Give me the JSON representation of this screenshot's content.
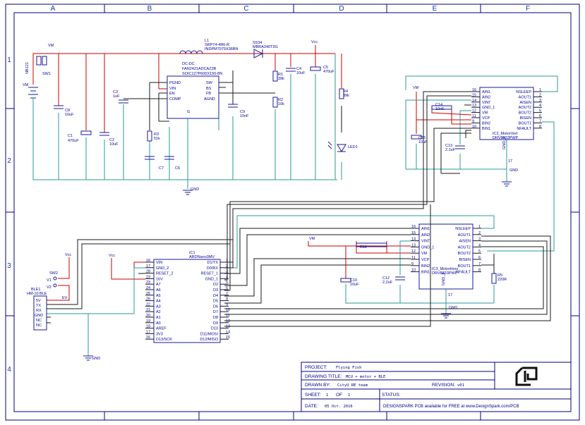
{
  "frame": {
    "columns": [
      "A",
      "B",
      "C",
      "D",
      "E",
      "F"
    ],
    "rows": [
      "1",
      "2",
      "3",
      "4"
    ]
  },
  "colors": {
    "wire_power": "#cc0000",
    "wire_signal": "#1a1a1a",
    "wire_ground": "#2a9a9a",
    "component": "#1a1a99",
    "label_text": "#000099",
    "frame": "#000080"
  },
  "power_section": {
    "vin_net": "VM",
    "vbat_net": "VM",
    "bat_label": "NB121",
    "switch_label": "SW1",
    "inductor": {
      "ref": "L1",
      "part": "SRP74-4R6-R",
      "value": "INDPM7979X36BN"
    },
    "diode": {
      "ref": "SS34",
      "part": "MBRA340T3G"
    },
    "vcc_net": "Vcc",
    "regulator": {
      "title": "DC-DC",
      "part": "FAN2421ADCAZ2B",
      "package": "SOIC127P600X150-8N",
      "pins_left": [
        "PGND",
        "VIN",
        "EN",
        "COMP"
      ],
      "pins_right": [
        "SW",
        "BS",
        "FB",
        "AGND"
      ],
      "pin_bottom": "G"
    },
    "caps": [
      {
        "ref": "C8",
        "value": "10uF"
      },
      {
        "ref": "C1",
        "value": "470uF"
      },
      {
        "ref": "C2",
        "value": "10uF"
      },
      {
        "ref": "C3",
        "value": "1uF"
      },
      {
        "ref": "C7",
        "value": ""
      },
      {
        "ref": "C6",
        "value": ""
      },
      {
        "ref": "C9",
        "value": "10nF"
      },
      {
        "ref": "C4",
        "value": "10uF"
      },
      {
        "ref": "C5",
        "value": "470uF"
      }
    ],
    "resistors": [
      {
        "ref": "R1",
        "value": "39k"
      },
      {
        "ref": "R2",
        "value": "10k"
      },
      {
        "ref": "R3",
        "value": "51k"
      },
      {
        "ref": "R4",
        "value": "39k"
      }
    ],
    "led": "LED1",
    "gnd": "GND"
  },
  "driver1": {
    "ref": "IC2_MotorVert",
    "part": "DRV8833PWP",
    "pins_left": [
      {
        "num": "16",
        "name": "AIN1"
      },
      {
        "num": "15",
        "name": "AIN2"
      },
      {
        "num": "14",
        "name": "VINT"
      },
      {
        "num": "13",
        "name": "GND_1"
      },
      {
        "num": "12",
        "name": "VM"
      },
      {
        "num": "11",
        "name": "VCP"
      },
      {
        "num": "9",
        "name": "BIN2"
      },
      {
        "num": "10",
        "name": "BIN1"
      }
    ],
    "pins_right": [
      {
        "num": "1",
        "name": "NSLEEP"
      },
      {
        "num": "2",
        "name": "AOUT1"
      },
      {
        "num": "3",
        "name": "AISEN"
      },
      {
        "num": "4",
        "name": "AOUT2"
      },
      {
        "num": "5",
        "name": "BOUT2"
      },
      {
        "num": "6",
        "name": "BISEN"
      },
      {
        "num": "7",
        "name": "BOUT1"
      },
      {
        "num": "8",
        "name": "NFAULT"
      }
    ],
    "pin_bottom": {
      "num": "17",
      "name": "GND_2"
    },
    "vm_net": "VM",
    "c14": {
      "ref": "C14",
      "value": "10nF"
    },
    "c15": {
      "ref": "C15",
      "value": "10uF"
    },
    "c13": {
      "ref": "C13",
      "value": "2.2uF"
    },
    "gnd": "GND"
  },
  "driver2": {
    "ref": "IC3_MotorHorz",
    "part": "DRV8833PWP",
    "pins_left": [
      {
        "num": "16",
        "name": "AIN1"
      },
      {
        "num": "15",
        "name": "AIN2"
      },
      {
        "num": "14",
        "name": "VINT"
      },
      {
        "num": "13",
        "name": "GND_1"
      },
      {
        "num": "12",
        "name": "VM"
      },
      {
        "num": "11",
        "name": "VCP"
      },
      {
        "num": "9",
        "name": "BIN2"
      },
      {
        "num": "10",
        "name": "BIN1"
      }
    ],
    "pins_right": [
      {
        "num": "1",
        "name": "NSLEEP"
      },
      {
        "num": "2",
        "name": "AOUT1"
      },
      {
        "num": "3",
        "name": "AISEN"
      },
      {
        "num": "4",
        "name": "AOUT2"
      },
      {
        "num": "5",
        "name": "BOUT2"
      },
      {
        "num": "6",
        "name": "BISEN"
      },
      {
        "num": "7",
        "name": "BOUT1"
      },
      {
        "num": "8",
        "name": "NFAULT"
      }
    ],
    "pin_bottom": {
      "num": "17",
      "name": "GND_2"
    },
    "vm_net": "VM",
    "c11": {
      "ref": "C11",
      "value": ""
    },
    "c10": {
      "ref": "C10",
      "value": "10uF"
    },
    "c12": {
      "ref": "C12",
      "value": "2.2uF"
    },
    "r5": {
      "ref": "R5",
      "value": "220R"
    },
    "gnd": "GND"
  },
  "mcu": {
    "ref": "IC1",
    "part": "ARDNano3MV",
    "pins_left": [
      {
        "num": "16",
        "name": "VIN"
      },
      {
        "num": "17",
        "name": "GND_2"
      },
      {
        "num": "28",
        "name": "RESET_2"
      },
      {
        "num": "19",
        "name": "16V"
      },
      {
        "num": "23",
        "name": "A7"
      },
      {
        "num": "24",
        "name": "A6"
      },
      {
        "num": "25",
        "name": "A5"
      },
      {
        "num": "26",
        "name": "A4"
      },
      {
        "num": "22",
        "name": "A3"
      },
      {
        "num": "21",
        "name": "A2"
      },
      {
        "num": "20",
        "name": "A1"
      },
      {
        "num": "19",
        "name": "A0"
      },
      {
        "num": "18",
        "name": "AREF"
      },
      {
        "num": "17",
        "name": "3V3"
      },
      {
        "num": "16",
        "name": "D13/SCK"
      }
    ],
    "pins_right": [
      {
        "num": "1",
        "name": "D1/TX"
      },
      {
        "num": "2",
        "name": "D0/RX"
      },
      {
        "num": "3",
        "name": "RESET_1"
      },
      {
        "num": "4",
        "name": "GND_1"
      },
      {
        "num": "5",
        "name": "D2"
      },
      {
        "num": "6",
        "name": "D3"
      },
      {
        "num": "7",
        "name": "D4"
      },
      {
        "num": "8",
        "name": "D5"
      },
      {
        "num": "9",
        "name": "D6"
      },
      {
        "num": "10",
        "name": "D7"
      },
      {
        "num": "11",
        "name": "D8"
      },
      {
        "num": "12",
        "name": "D9"
      },
      {
        "num": "13",
        "name": "D10"
      },
      {
        "num": "14",
        "name": "D11/MOSI"
      },
      {
        "num": "15",
        "name": "D12/MISO"
      }
    ],
    "vcc_net": "Vcc"
  },
  "ble": {
    "ref": "BLE1",
    "part": "HM-10 BLE",
    "pins": [
      "5V",
      "TX",
      "RX",
      "GND",
      "NC",
      "NC"
    ],
    "switch": "SW2",
    "vcc_net": "Vcc",
    "r_labels": [
      "V1",
      "V2"
    ],
    "ev_label": "EV",
    "gnd": "GND"
  },
  "title_block": {
    "project_label": "PROJECT:",
    "project": "Flying Fish",
    "drawing_title_label": "DRAWING TITLE:",
    "drawing_title": "MCU + motor + BLE",
    "drawn_by_label": "DRAWN BY:",
    "drawn_by": "CityU RE team",
    "revision_label": "REVISION:",
    "revision": "v01",
    "sheet_label": "SHEET:",
    "sheet": "1",
    "of_label": "OF",
    "of": "1",
    "status_label": "STATUS:",
    "status": "",
    "date_label": "DATE:",
    "date": "05 Oct. 2016",
    "footer": "DESIGNSPARK PCB available for FREE at www.DesignSpark.com/PCB"
  }
}
